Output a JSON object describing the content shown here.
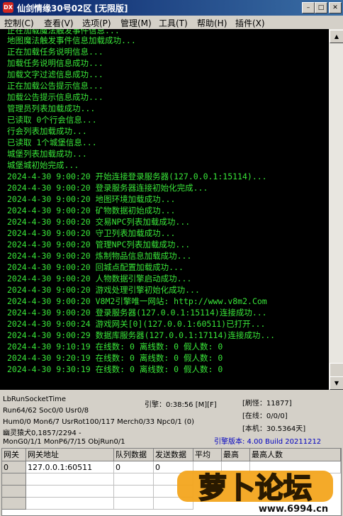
{
  "window": {
    "icon_text": "DX",
    "title": "仙剑情缘30号02区 [无限版]",
    "buttons": {
      "minimize": "–",
      "maximize": "□",
      "close": "✕"
    }
  },
  "menu": [
    "控制(C)",
    "查看(V)",
    "选项(P)",
    "管理(M)",
    "工具(T)",
    "帮助(H)",
    "插件(X)"
  ],
  "log_lines": [
    "正在加载魔法触发事件信息...",
    "地图魔法触发事件信息加载成功...",
    "正在加载任务说明信息...",
    "加载任务说明信息成功...",
    "加载文字过滤信息成功...",
    "正在加载公告提示信息...",
    "加载公告提示信息成功...",
    "管理员列表加载成功...",
    "已读取 0个行会信息...",
    "行会列表加载成功...",
    "已读取 1个城堡信息...",
    "城堡列表加载成功...",
    "城堡城初始完成...",
    "2024-4-30 9:00:20 开始连接登录服务器(127.0.0.1:15114)...",
    "2024-4-30 9:00:20 登录服务器连接初始化完成...",
    "2024-4-30 9:00:20 地图环境加载成功...",
    "2024-4-30 9:00:20 矿物数据初始成功...",
    "2024-4-30 9:00:20 交易NPC列表加载成功...",
    "2024-4-30 9:00:20 守卫列表加载成功...",
    "2024-4-30 9:00:20 管理NPC列表加载成功...",
    "2024-4-30 9:00:20 炼制物品信息加载成功...",
    "2024-4-30 9:00:20 回城点配置加载成功...",
    "2024-4-30 9:00:20 人物数据引擎启动成功...",
    "2024-4-30 9:00:20 游戏处理引擎初始化成功...",
    "2024-4-30 9:00:20 V8M2引擎唯一网站: http://www.v8m2.Com",
    "2024-4-30 9:00:20 登录服务器(127.0.0.1:15114)连接成功...",
    "2024-4-30 9:00:24 游戏网关[0](127.0.0.1:60511)已打开...",
    "2024-4-30 9:00:29 数据库服务器(127.0.0.1:17114)连接成功...",
    "2024-4-30 9:10:19 在线数: 0 离线数: 0 假人数: 0",
    "2024-4-30 9:20:19 在线数: 0 离线数: 0 假人数: 0",
    "2024-4-30 9:30:19 在线数: 0 离线数: 0 假人数: 0"
  ],
  "status": {
    "socket_time": "LbRunSocketTime",
    "run_line": "Run64/62 Soc0/0 Usr0/8",
    "engine_time": "引擎：0:38:56 [M][F]",
    "refresh": "[刷怪：11877]",
    "hum_line": "Hum0/0 Mon6/7 UsrRot100/117 Merch0/33 Npc0/1 (0)",
    "online": "[在线：0/0/0]",
    "ghost_line": "幽灵猿犬0,1857/2294 -",
    "machine": "[本机：30.5364天]",
    "mon_line": "MonG0/1/1 MonP6/7/15 ObjRun0/1",
    "version": "引擎版本: 4.00 Build 20211212"
  },
  "grid": {
    "headers": [
      "网关",
      "网关地址",
      "队列数据",
      "发送数据",
      "平均",
      "最高",
      "最高人数"
    ],
    "rows": [
      [
        "0",
        "127.0.0.1:60511",
        "0",
        "0",
        "",
        "",
        ""
      ]
    ]
  },
  "watermark": {
    "text": "萝卜论坛",
    "url": "www.6994.cn"
  },
  "colors": {
    "log_text": "#39e639",
    "log_bg": "#000000",
    "title_bar": "#0a246a",
    "version_text": "#0000c0"
  }
}
